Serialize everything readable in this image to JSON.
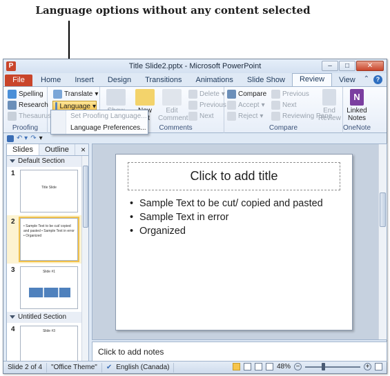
{
  "caption": "Language options without any content selected",
  "window": {
    "title": "Title Slide2.pptx - Microsoft PowerPoint",
    "app_icon": "P"
  },
  "tabs": [
    "File",
    "Home",
    "Insert",
    "Design",
    "Transitions",
    "Animations",
    "Slide Show",
    "Review",
    "View"
  ],
  "active_tab": "Review",
  "ribbon": {
    "proofing": {
      "spelling": "Spelling",
      "research": "Research",
      "thesaurus": "Thesaurus",
      "label": "Proofing"
    },
    "language": {
      "translate": "Translate",
      "language": "Language"
    },
    "comments": {
      "show": "Show",
      "new": "New",
      "new2": "ent",
      "edit": "Edit",
      "edit2": "Comment",
      "delete": "Delete",
      "previous": "Previous",
      "next": "Next",
      "label": "Comments"
    },
    "compare": {
      "compare": "Compare",
      "accept": "Accept",
      "reject": "Reject",
      "previous": "Previous",
      "next": "Next",
      "reviewing_pane": "Reviewing Pane",
      "end": "End",
      "review": "Review",
      "label": "Compare"
    },
    "onenote": {
      "linked": "Linked",
      "notes": "Notes",
      "label": "OneNote"
    }
  },
  "dropdown": {
    "set_proofing": "Set Proofing Language...",
    "preferences": "Language Preferences..."
  },
  "panel": {
    "tab_slides": "Slides",
    "tab_outline": "Outline",
    "close": "×",
    "sections": [
      "Default Section",
      "Untitled Section"
    ],
    "thumbs": [
      {
        "num": "1",
        "text": "Title Slide"
      },
      {
        "num": "2",
        "text": "• Sample Text to be cut/ copied and pasted • Sample Text in error • Organized"
      },
      {
        "num": "3",
        "text": "Slide #1"
      },
      {
        "num": "4",
        "text": "Slide #3"
      }
    ]
  },
  "slide": {
    "title_placeholder": "Click to add title",
    "bullets": [
      "Sample Text to be cut/ copied and pasted",
      "Sample Text in error",
      "Organized"
    ]
  },
  "notes_placeholder": "Click to add notes",
  "status": {
    "slide": "Slide 2 of 4",
    "theme": "\"Office Theme\"",
    "language": "English (Canada)",
    "zoom": "48%"
  },
  "colors": {
    "file_tab": "#c9452b",
    "highlight": "#f7c54c",
    "frame": "#dfe9f5"
  }
}
